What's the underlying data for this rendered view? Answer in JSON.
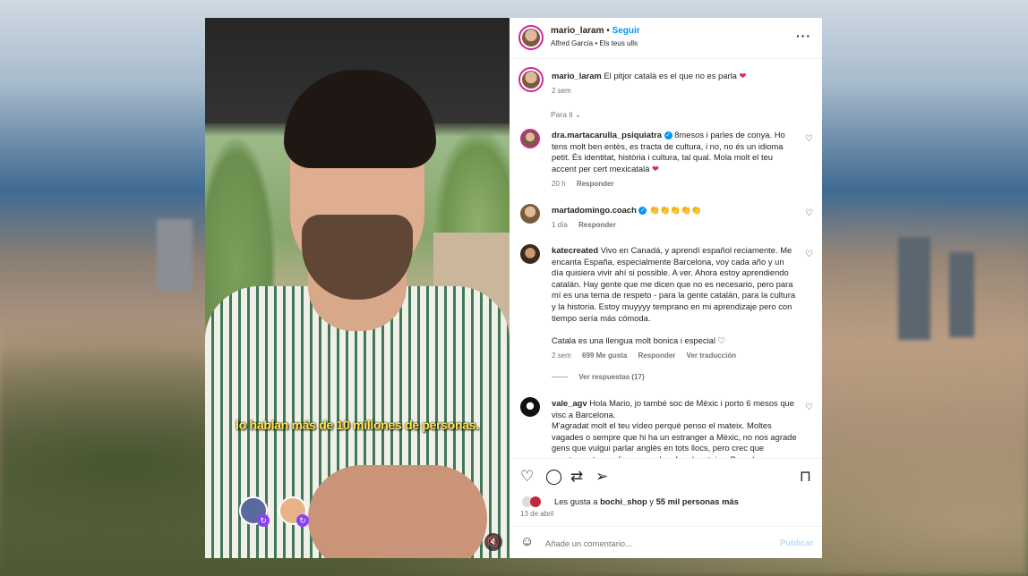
{
  "video": {
    "subtitle": "lo hablan más de 10 millones de personas.",
    "mute_icon": "speaker-muted-icon"
  },
  "post": {
    "username": "mario_laram",
    "follow_label": "Seguir",
    "audio": "Alfred García • Els teus ulls",
    "caption_user": "mario_laram",
    "caption_text": "El pitjor català es el que no es parla",
    "caption_time": "2 sem",
    "sort_label": "Para ti"
  },
  "comments": [
    {
      "user": "dra.martacarulla_psiquiatra",
      "verified": true,
      "text": "8mesos i parles de conya. Ho tens molt ben entès, es tracta de cultura, i no, no és un idioma petit. És identitat, història i cultura, tal qual. Mola molt el teu accent per cert mexicatalà",
      "time": "20 h",
      "reply": "Responder"
    },
    {
      "user": "martadomingo.coach",
      "verified": true,
      "text": "👏👏👏👏👏",
      "time": "1 día",
      "reply": "Responder"
    },
    {
      "user": "katecreated",
      "verified": false,
      "text": "Vivo en Canadá, y aprendí español reciamente. Me encanta España, especialmente Barcelona, voy cada año y un día quisiera vivir ahí si possible. A ver. Ahora estoy aprendiendo catalán. Hay gente que me dicen que no es necesario, pero para mí es una tema de respeto - para la gente catalán, para la cultura y la historia. Estoy muyyyy temprano en mi aprendizaje pero con tiempo sería más cómoda.",
      "text2": "Catala es una llengua molt bonica i especial",
      "time": "2 sem",
      "likes": "699 Me gusta",
      "reply": "Responder",
      "translate": "Ver traducción",
      "view_replies": "Ver respuestas (17)"
    },
    {
      "user": "vale_agv",
      "verified": false,
      "text": "Hola Mario, jo també soc de Mèxic i porto 6 mesos que visc a Barcelona.",
      "text2": "M'agradat molt el teu vídeo perquè penso el mateix. Moltes vagades o sempre que hi ha un estranger a Mèxic, no nos agrade gens que vulgui parlar anglès en tots llocs, pero crec que exactament com dius, no podem fer el mateix a Barcelona"
    }
  ],
  "footer": {
    "likes_prefix": "Les gusta a ",
    "likes_user": "bochi_shop",
    "likes_mid": " y ",
    "likes_count": "55 mil personas más",
    "date": "13 de abril",
    "add_comment_placeholder": "Añade un comentario...",
    "publish": "Publicar"
  },
  "colors": {
    "accent": "#0095f6",
    "heart": "#e0245e",
    "subtitle": "#ffe84a"
  }
}
